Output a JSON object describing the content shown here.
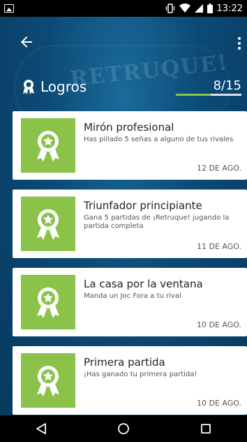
{
  "status_bar": {
    "time": "13:22",
    "icons": [
      "image-icon",
      "vibrate-icon",
      "wifi-icon",
      "signal-icon",
      "battery-icon"
    ]
  },
  "app_bar": {
    "back_icon": "arrow-back-icon",
    "menu_icon": "more-vert-icon",
    "background_watermark": "RETRUQUE!"
  },
  "header": {
    "title": "Logros",
    "title_icon": "award-icon",
    "count": "8/15",
    "progress": 0.5333
  },
  "achievements": [
    {
      "title": "Mirón profesional",
      "description": "Has pillado 5 señas a alguno de tus rivales",
      "date": "12 DE AGO.",
      "icon": "award-ribbon-icon"
    },
    {
      "title": "Triunfador principiante",
      "description": "Gana 5 partidas de ¡Retruque! jugando la partida completa",
      "date": "11 DE AGO.",
      "icon": "award-ribbon-icon"
    },
    {
      "title": "La casa por la ventana",
      "description": "Manda un Joc Fora a tu rival",
      "date": "10 DE AGO.",
      "icon": "award-ribbon-icon"
    },
    {
      "title": "Primera partida",
      "description": "¡Has ganado tu primera partida!",
      "date": "10 DE AGO.",
      "icon": "award-ribbon-icon"
    }
  ],
  "colors": {
    "accent": "#8bc34a",
    "background": "#0c4a76",
    "card": "#ffffff"
  },
  "nav_bar": {
    "buttons": [
      "back-triangle-icon",
      "home-circle-icon",
      "recents-square-icon"
    ]
  }
}
